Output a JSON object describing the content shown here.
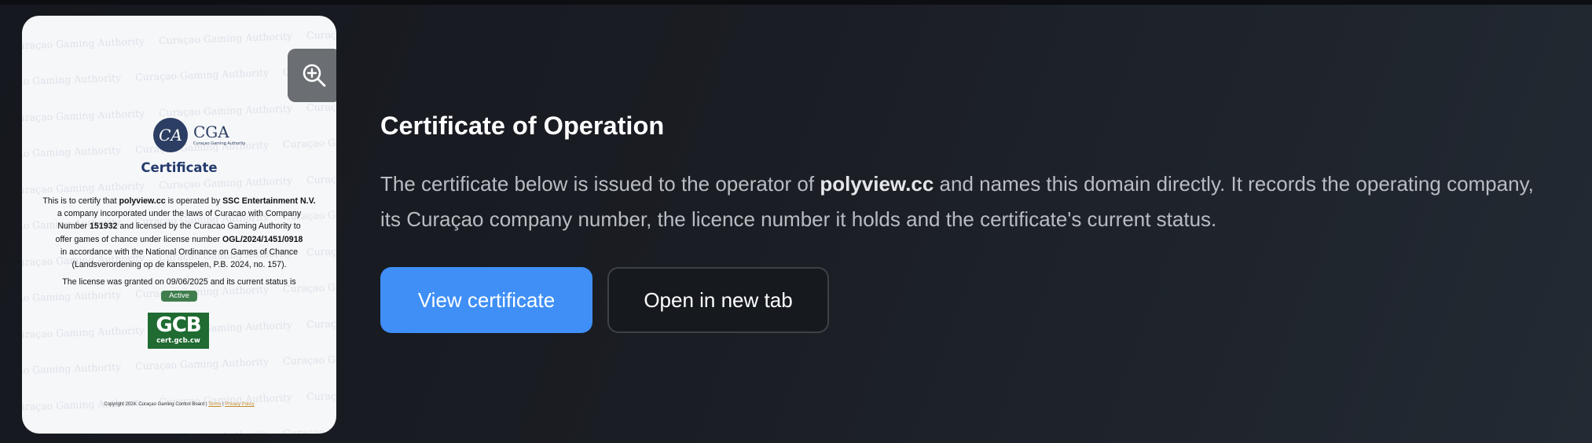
{
  "certificate_card": {
    "watermark_text": "Curaçao Gaming Authority",
    "logo": {
      "monogram": "CGA",
      "name": "CGA",
      "subtitle": "Curaçao Gaming Authority"
    },
    "title": "Certificate",
    "body": {
      "intro": "This is to certify that",
      "domain": "polyview.cc",
      "is_operated_by": "is operated by",
      "operator": "SSC Entertainment N.V.",
      "line_incorporated": "a company incorporated under the laws of Curacao with Company",
      "company_number_label": "Number",
      "company_number": "151932",
      "licensed_text": "and licensed by the Curacao Gaming Authority to",
      "license_prefix": "offer games of chance under license number",
      "license_number": "OGL/2024/1451/0918",
      "line_ordinance": "in accordance with the National Ordinance on Games of Chance",
      "line_landsverordening": "(Landsverordening op de kansspelen, P.B. 2024, no. 157)."
    },
    "status_line": "The license was granted on 09/06/2025 and its current status is",
    "status_badge": "Active",
    "seal": {
      "big": "GCB",
      "small": "cert.gcb.cw"
    },
    "footer": {
      "copyright": "Copyright 2024. Curaçao Gaming Control Board |",
      "terms": "Terms",
      "separator": "|",
      "privacy": "Privacy Policy"
    },
    "zoom_icon": "zoom-in-icon"
  },
  "info": {
    "heading": "Certificate of Operation",
    "desc_part1": "The certificate below is issued to the operator of",
    "desc_domain": "polyview.cc",
    "desc_part2": "and names this domain directly. It records the operating company, its Curaçao company number, the licence number it holds and the certificate's current status."
  },
  "buttons": {
    "view_certificate": "View certificate",
    "open_new_tab": "Open in new tab"
  },
  "colors": {
    "primary_button": "#3f8ff7",
    "badge_active": "#3f7d4d",
    "seal_green": "#1f6b32",
    "cga_navy": "#233a6b"
  }
}
